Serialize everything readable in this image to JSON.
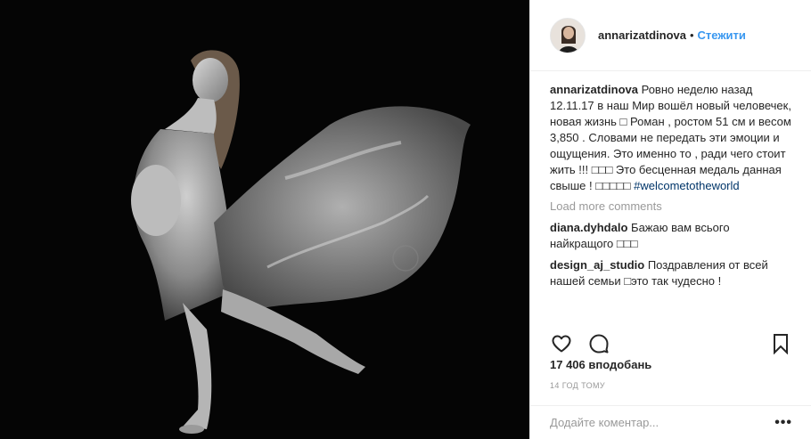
{
  "post": {
    "author": "annarizatdinova",
    "separator": "•",
    "follow_label": "Стежити",
    "caption": {
      "username": "annarizatdinova",
      "text": "Ровно неделю назад 12.11.17 в наш Мир вошёл новый человечек, новая жизнь □ Роман , ростом 51 см и весом 3,850 . Словами не передать эти эмоции и ощущения. Это именно то , ради чего стоит жить !!! □□□ Это бесценная медаль данная свыше ! □□□□□ ",
      "hashtag": "#welcometotheworld"
    },
    "load_more": "Load more comments",
    "comments": [
      {
        "username": "diana.dyhdalo",
        "text": "Бажаю вам всього найкращого □□□"
      },
      {
        "username": "design_aj_studio",
        "text": "Поздравления от всей нашей семьи □это так чудесно !"
      }
    ],
    "actions": {
      "like_icon": "heart-icon",
      "comment_icon": "comment-icon",
      "save_icon": "bookmark-icon"
    },
    "likes": "17 406 вподобань",
    "time": "14 год тому",
    "add_comment_placeholder": "Додайте коментар...",
    "more_label": "•••"
  },
  "colors": {
    "link": "#3897f0",
    "hashtag": "#003569",
    "muted": "#999999"
  }
}
